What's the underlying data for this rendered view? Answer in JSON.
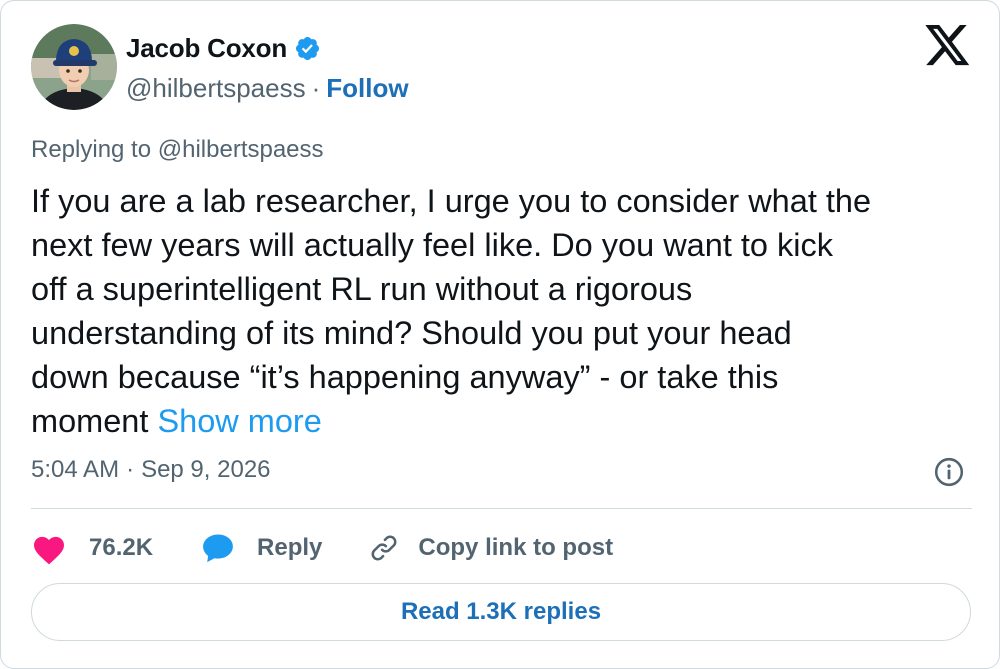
{
  "author": {
    "display_name": "Jacob Coxon",
    "handle": "@hilbertspaess",
    "separator": "·",
    "follow_label": "Follow",
    "verified": true,
    "verified_color": "#1d9bf0"
  },
  "reply_context": {
    "prefix": "Replying to ",
    "handle": "@hilbertspaess"
  },
  "tweet": {
    "lines": [
      "If you are a lab researcher, I urge you to consider what the",
      "next few years will actually feel like. Do you want to kick",
      "off a superintelligent RL run without a rigorous",
      "understanding of its mind? Should you put your head",
      "down because “it’s happening anyway” - or take this",
      "moment "
    ],
    "show_more_label": "Show more"
  },
  "meta": {
    "time": "5:04 AM",
    "separator": "·",
    "date": "Sep 9, 2026"
  },
  "actions": {
    "like_count": "76.2K",
    "reply_label": "Reply",
    "copy_link_label": "Copy link to post"
  },
  "read_replies_label": "Read 1.3K replies",
  "colors": {
    "text": "#0f1419",
    "secondary": "#536471",
    "link_dark": "#1d70b8",
    "link": "#1d9bf0",
    "like": "#f91880",
    "border": "#cfd9de"
  },
  "icons": [
    "avatar-photo",
    "verified-badge-icon",
    "x-logo-icon",
    "info-icon",
    "heart-icon",
    "speech-bubble-icon",
    "link-icon"
  ]
}
